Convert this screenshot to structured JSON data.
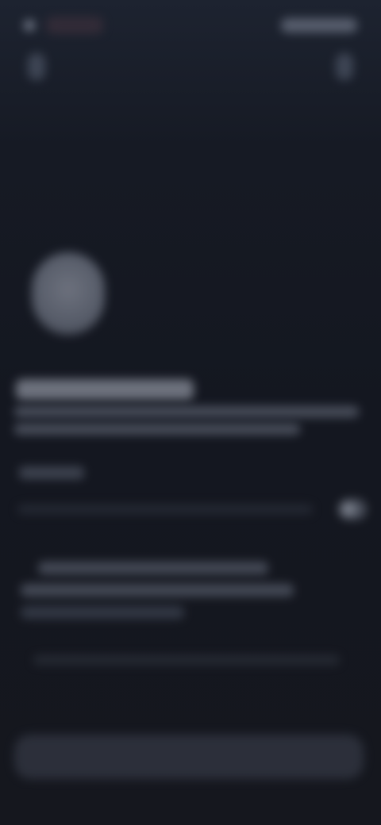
{
  "status_bar": {
    "time": "",
    "indicators": ""
  },
  "nav": {
    "back_icon": "back-icon",
    "more_icon": "more-icon"
  },
  "profile": {
    "display_name": "",
    "bio_line_1": "",
    "bio_line_2": ""
  },
  "section": {
    "label": "",
    "setting_text": "",
    "toggle_icon": "toggle-icon"
  },
  "info": {
    "line_1": "",
    "line_2": "",
    "line_3": ""
  },
  "footer_note": "",
  "primary_button": {
    "label": ""
  },
  "colors": {
    "background": "#14171f",
    "button": "#343844",
    "text_muted": "#5c6270"
  }
}
